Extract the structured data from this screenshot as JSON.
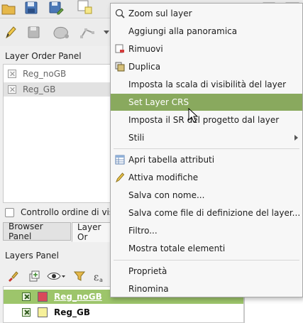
{
  "layer_order_panel": {
    "title": "Layer Order Panel",
    "items": [
      "Reg_noGB",
      "Reg_GB"
    ],
    "control_label": "Controllo ordine di visu"
  },
  "tabs": {
    "browser": "Browser Panel",
    "layer_order": "Layer Or"
  },
  "layers_panel": {
    "title": "Layers Panel",
    "layers": [
      {
        "name": "Reg_noGB",
        "color": "#d9495a",
        "selected": true
      },
      {
        "name": "Reg_GB",
        "color": "#f6f09a",
        "selected": false
      }
    ]
  },
  "context_menu": {
    "items": [
      "Zoom sul layer",
      "Aggiungi alla panoramica",
      "Rimuovi",
      "Duplica",
      "Imposta la scala di visibilità del layer",
      "Set Layer CRS",
      "Imposta il SR del progetto dal layer",
      "Stili",
      "Apri tabella attributi",
      "Attiva modifiche",
      "Salva con nome...",
      "Salva come file di definizione del layer...",
      "Filtro...",
      "Mostra totale elementi",
      "Proprietà",
      "Rinomina"
    ],
    "highlighted": "Set Layer CRS",
    "highlight_color": "#89a95e"
  },
  "colors": {
    "selected_row": "#9dc56b"
  }
}
